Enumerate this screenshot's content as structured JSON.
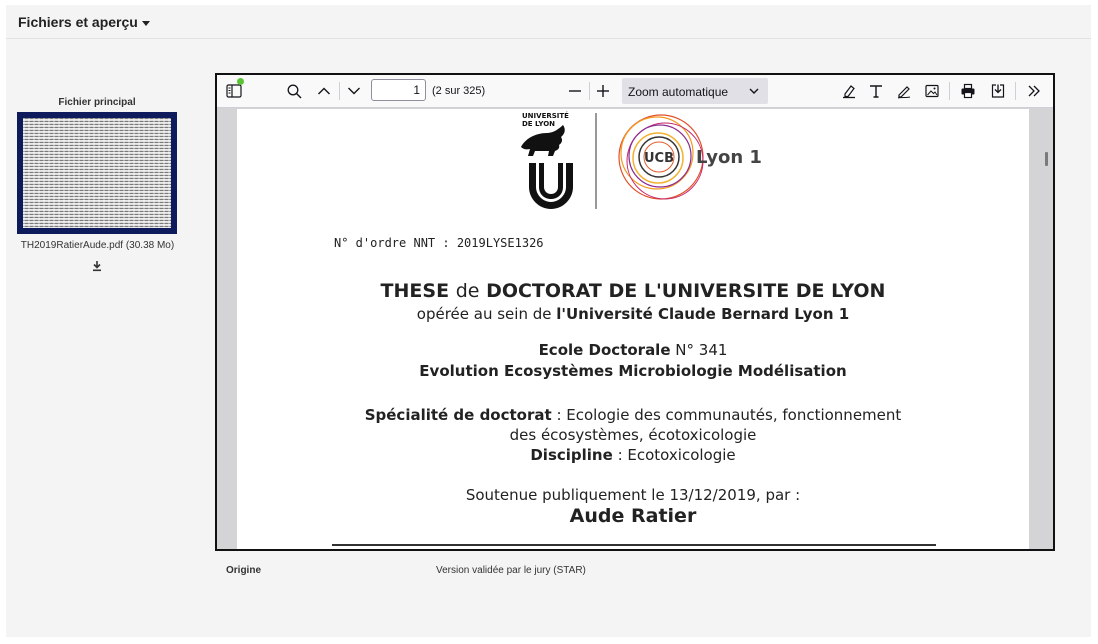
{
  "panel": {
    "title": "Fichiers et aperçu"
  },
  "sidebar": {
    "label": "Fichier principal",
    "file_name": "TH2019RatierAude.pdf (30.38 Mo)",
    "download_icon": "download-icon"
  },
  "toolbar": {
    "page_value": "1",
    "page_count": "(2 sur 325)",
    "zoom_label": "Zoom automatique",
    "icons": [
      "sidebar-toggle-icon",
      "search-icon",
      "chevron-up-icon",
      "chevron-down-icon",
      "minus-icon",
      "plus-icon",
      "highlight-icon",
      "text-icon",
      "draw-icon",
      "image-icon",
      "print-icon",
      "save-icon",
      "double-chevron-right-icon"
    ]
  },
  "document": {
    "logo_ul_top": "UNIVERSITÉ",
    "logo_ul_bottom": "DE LYON",
    "logo_lyon1_mark": "UCB",
    "logo_lyon1_text": "Lyon 1",
    "nnt": "N° d'ordre NNT : 2019LYSE1326",
    "title_part1": "THESE",
    "title_part2": "de",
    "title_part3": "DOCTORAT DE L'UNIVERSITE DE LYON",
    "operee_prefix": "opérée au sein de",
    "operee_univ": "l'Université Claude Bernard Lyon 1",
    "ecole_label": "Ecole Doctorale",
    "ecole_num": "N° 341",
    "ecole_name": "Evolution Ecosystèmes Microbiologie Modélisation",
    "specialite_label": "Spécialité de doctorat",
    "specialite_value_1": ": Ecologie des communautés, fonctionnement",
    "specialite_value_2": "des écosystèmes, écotoxicologie",
    "discipline_label": "Discipline",
    "discipline_value": ": Ecotoxicologie",
    "soutenue": "Soutenue publiquement le 13/12/2019, par :",
    "author": "Aude Ratier"
  },
  "meta": {
    "origine_label": "Origine",
    "origine_value": "Version validée par le jury (STAR)"
  },
  "colors": {
    "thumb_border": "#0d1a5c",
    "green_dot": "#5bc236",
    "toolbar_bg": "#f9f9fa"
  }
}
